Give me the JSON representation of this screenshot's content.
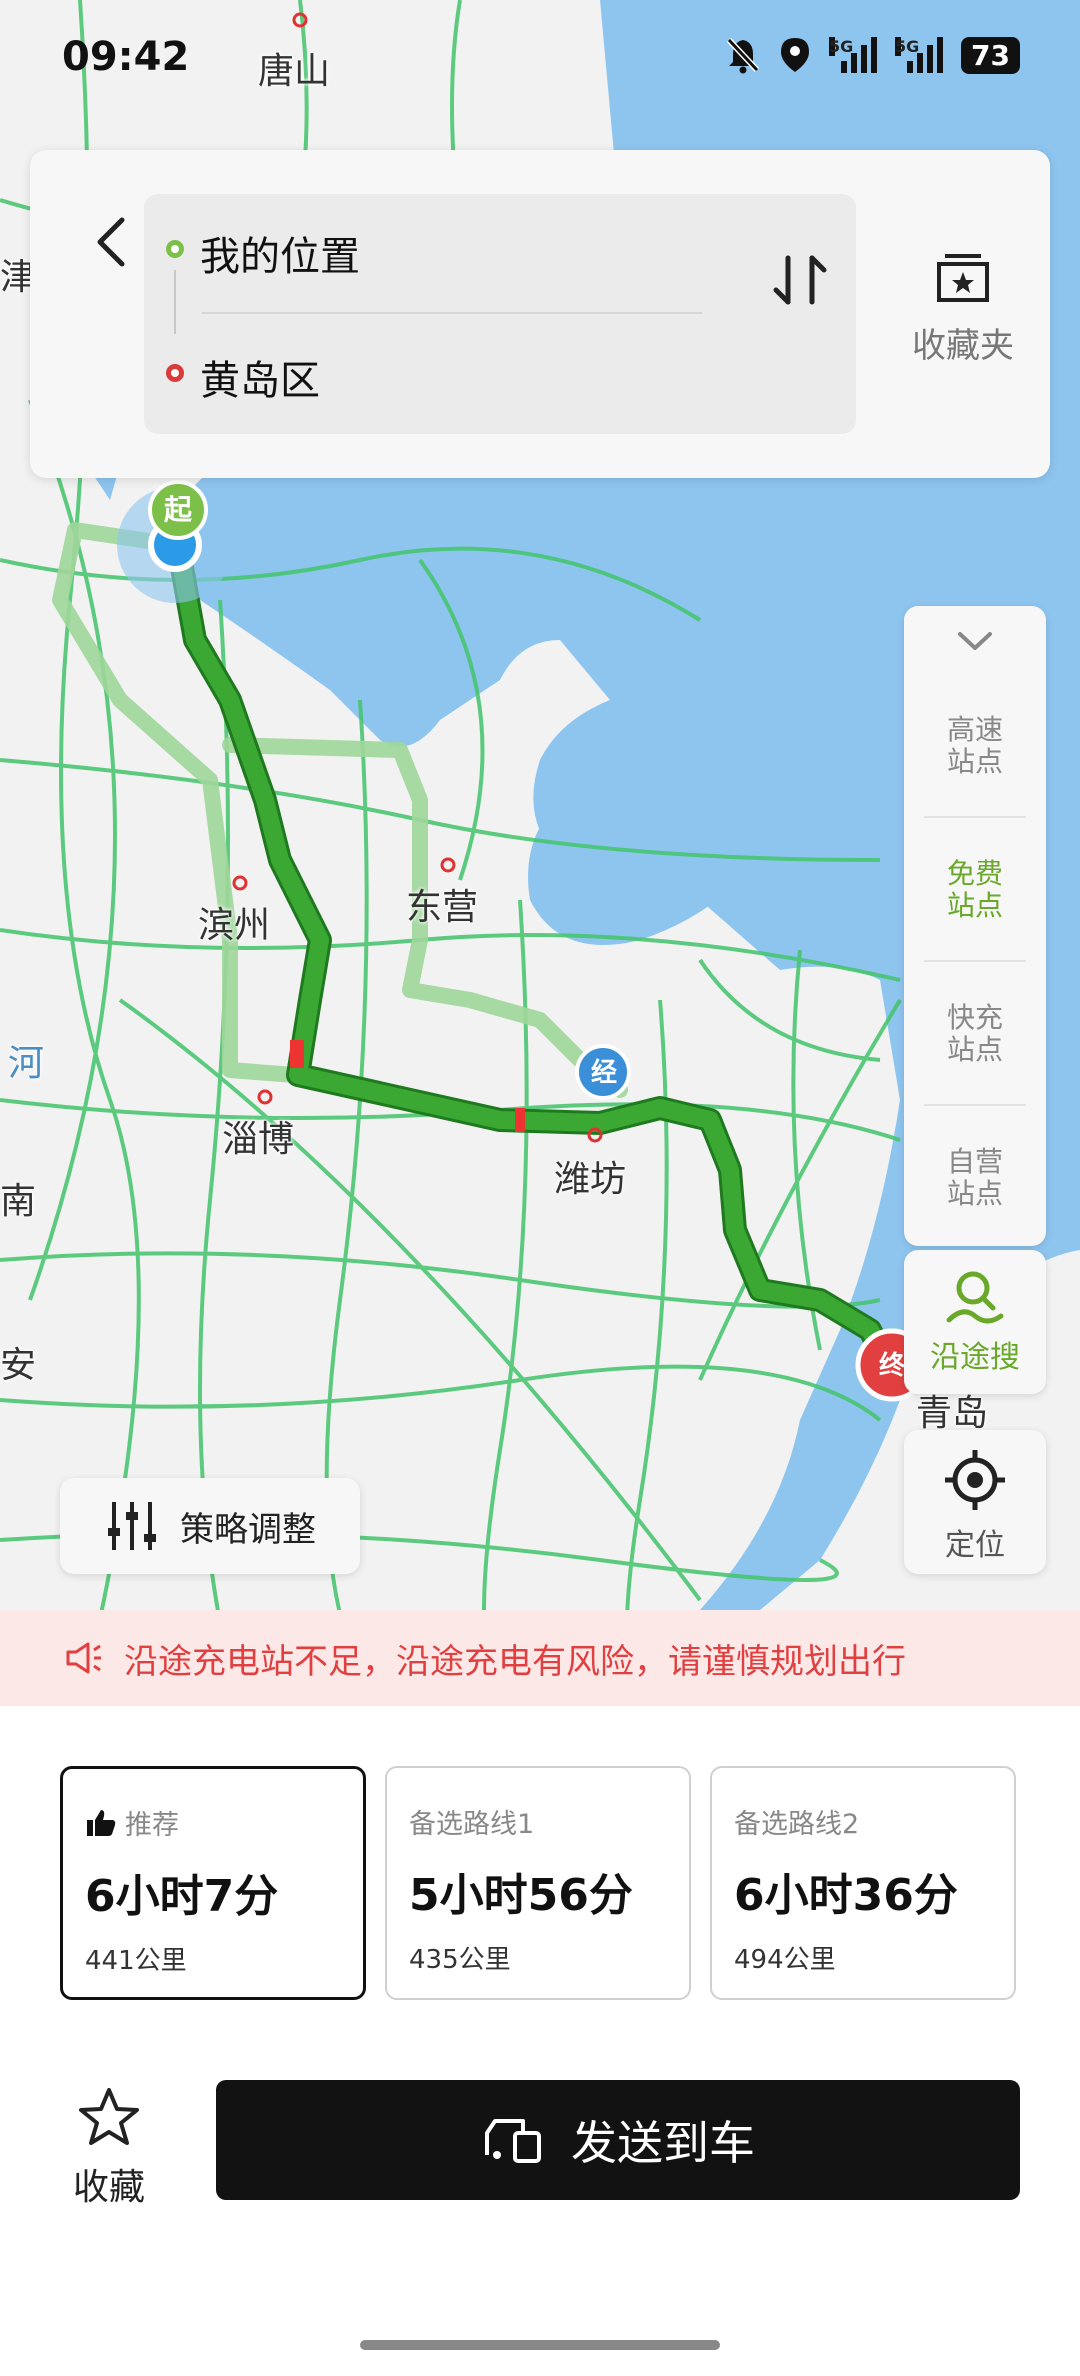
{
  "status_bar": {
    "time": "09:42",
    "battery": "73",
    "signal1_label": "5G",
    "signal2_label": "5G"
  },
  "map": {
    "cities": [
      "唐山",
      "滨州",
      "东营",
      "淄博",
      "潍坊",
      "青岛",
      "河",
      "南",
      "安",
      "津"
    ],
    "start_marker": "起",
    "via_marker": "经",
    "end_marker": "终",
    "colors": {
      "sea": "#8ec5ef",
      "land": "#f2f2f2",
      "road": "#43c46a",
      "route": "#3aa832",
      "route_border": "#1f7a1f"
    }
  },
  "route_panel": {
    "origin": "我的位置",
    "destination": "黄岛区",
    "favorites_folder": "收藏夹"
  },
  "side_panel": {
    "items": [
      {
        "label_line1": "高速",
        "label_line2": "站点"
      },
      {
        "label_line1": "免费",
        "label_line2": "站点"
      },
      {
        "label_line1": "快充",
        "label_line2": "站点"
      },
      {
        "label_line1": "自营",
        "label_line2": "站点"
      }
    ],
    "along_search": "沿途搜",
    "locate": "定位"
  },
  "strategy": {
    "label": "策略调整"
  },
  "warning": {
    "text": "沿途充电站不足，沿途充电有风险，请谨慎规划出行"
  },
  "routes": [
    {
      "tag": "推荐",
      "time": "6小时7分",
      "distance": "441公里",
      "selected": true
    },
    {
      "tag": "备选路线1",
      "time": "5小时56分",
      "distance": "435公里",
      "selected": false
    },
    {
      "tag": "备选路线2",
      "time": "6小时36分",
      "distance": "494公里",
      "selected": false
    }
  ],
  "actions": {
    "favorite": "收藏",
    "send_to_car": "发送到车"
  }
}
